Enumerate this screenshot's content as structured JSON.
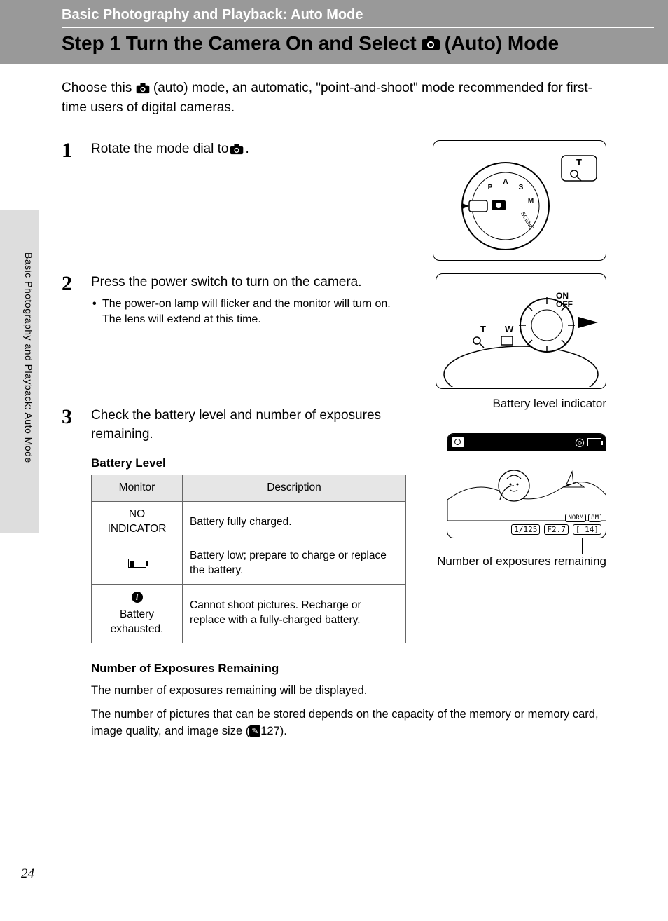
{
  "header": {
    "section": "Basic Photography and Playback: Auto Mode",
    "title_before": "Step 1 Turn the Camera On and Select",
    "title_after": "(Auto) Mode"
  },
  "intro": {
    "before": "Choose this",
    "after": "(auto) mode, an automatic, \"point-and-shoot\" mode recommended for first-time users of digital cameras."
  },
  "side_tab": "Basic Photography and Playback: Auto Mode",
  "steps": [
    {
      "num": "1",
      "text_before": "Rotate the mode dial to",
      "text_after": "."
    },
    {
      "num": "2",
      "text": "Press the power switch to turn on the camera.",
      "bullet": "The power-on lamp will flicker and the monitor will turn on. The lens will extend at this time."
    },
    {
      "num": "3",
      "text": "Check the battery level and number of exposures remaining.",
      "label_top": "Battery level indicator",
      "label_bottom": "Number of exposures remaining",
      "subhead1": "Battery Level",
      "table": {
        "head": [
          "Monitor",
          "Description"
        ],
        "rows": [
          {
            "monitor": "NO INDICATOR",
            "desc": "Battery fully charged."
          },
          {
            "monitor_icon": "battery-low",
            "desc": "Battery low; prepare to charge or replace the battery."
          },
          {
            "monitor_icon": "info",
            "monitor_text": "Battery exhausted.",
            "desc": "Cannot shoot pictures. Recharge or replace with a fully-charged battery."
          }
        ]
      },
      "subhead2": "Number of Exposures Remaining",
      "para1": "The number of exposures remaining will be displayed.",
      "para2_before": "The number of pictures that can be stored depends on the capacity of the memory or memory card, image quality, and image size (",
      "para2_ref": "127",
      "para2_after": ")."
    }
  ],
  "lcd": {
    "shutter": "1/125",
    "aperture": "F2.7",
    "mode": "NORM",
    "size": "8M",
    "remaining": "14"
  },
  "page_number": "24"
}
